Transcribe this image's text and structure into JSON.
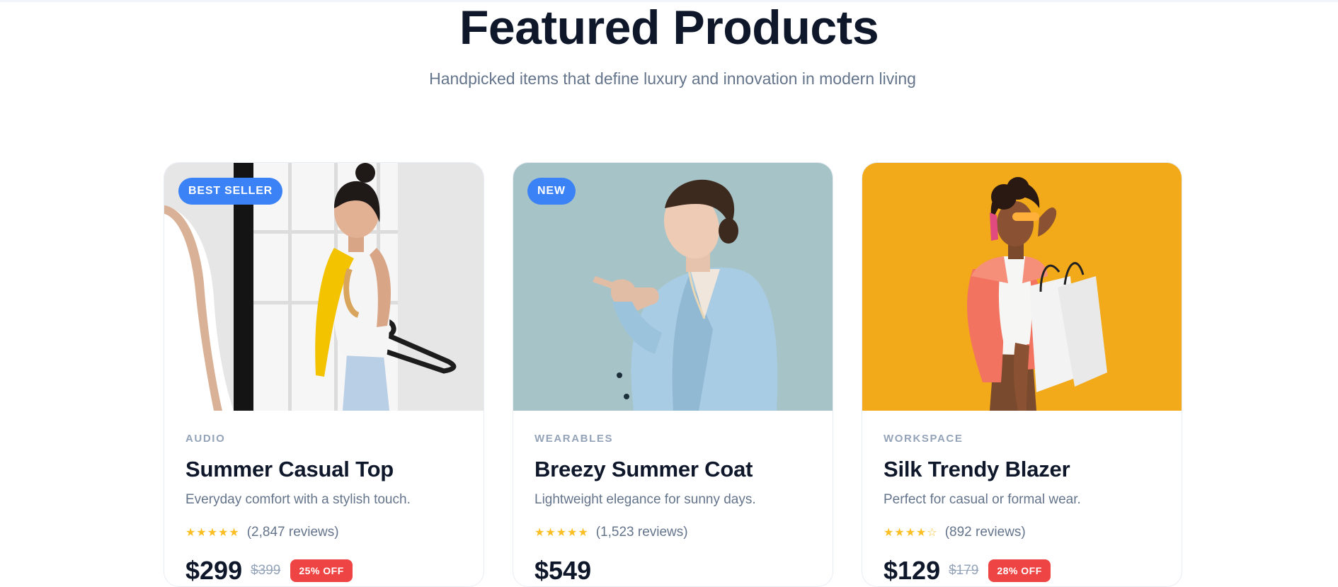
{
  "section": {
    "title": "Featured Products",
    "subtitle": "Handpicked items that define luxury and innovation in modern living"
  },
  "products": [
    {
      "badge": "BEST SELLER",
      "category": "AUDIO",
      "title": "Summer Casual Top",
      "description": "Everyday comfort with a stylish touch.",
      "stars": "★★★★★",
      "rating": 5,
      "reviews": "(2,847 reviews)",
      "price": "$299",
      "old_price": "$399",
      "discount": "25% OFF",
      "image_bg": "#e7e7e7",
      "badge_color": "#3b82f6"
    },
    {
      "badge": "NEW",
      "category": "WEARABLES",
      "title": "Breezy Summer Coat",
      "description": "Lightweight elegance for sunny days.",
      "stars": "★★★★★",
      "rating": 5,
      "reviews": "(1,523 reviews)",
      "price": "$549",
      "image_bg": "#a7c4c9",
      "badge_color": "#3b82f6"
    },
    {
      "category": "WORKSPACE",
      "title": "Silk Trendy Blazer",
      "description": "Perfect for casual or formal wear.",
      "stars": "★★★★☆",
      "rating": 4.5,
      "reviews": "(892 reviews)",
      "price": "$129",
      "old_price": "$179",
      "discount": "28% OFF",
      "image_bg": "#f2a91a"
    }
  ],
  "colors": {
    "title": "#0f172a",
    "muted": "#64748b",
    "accent": "#3b82f6",
    "star": "#fbbf24",
    "sale": "#ef4444"
  }
}
